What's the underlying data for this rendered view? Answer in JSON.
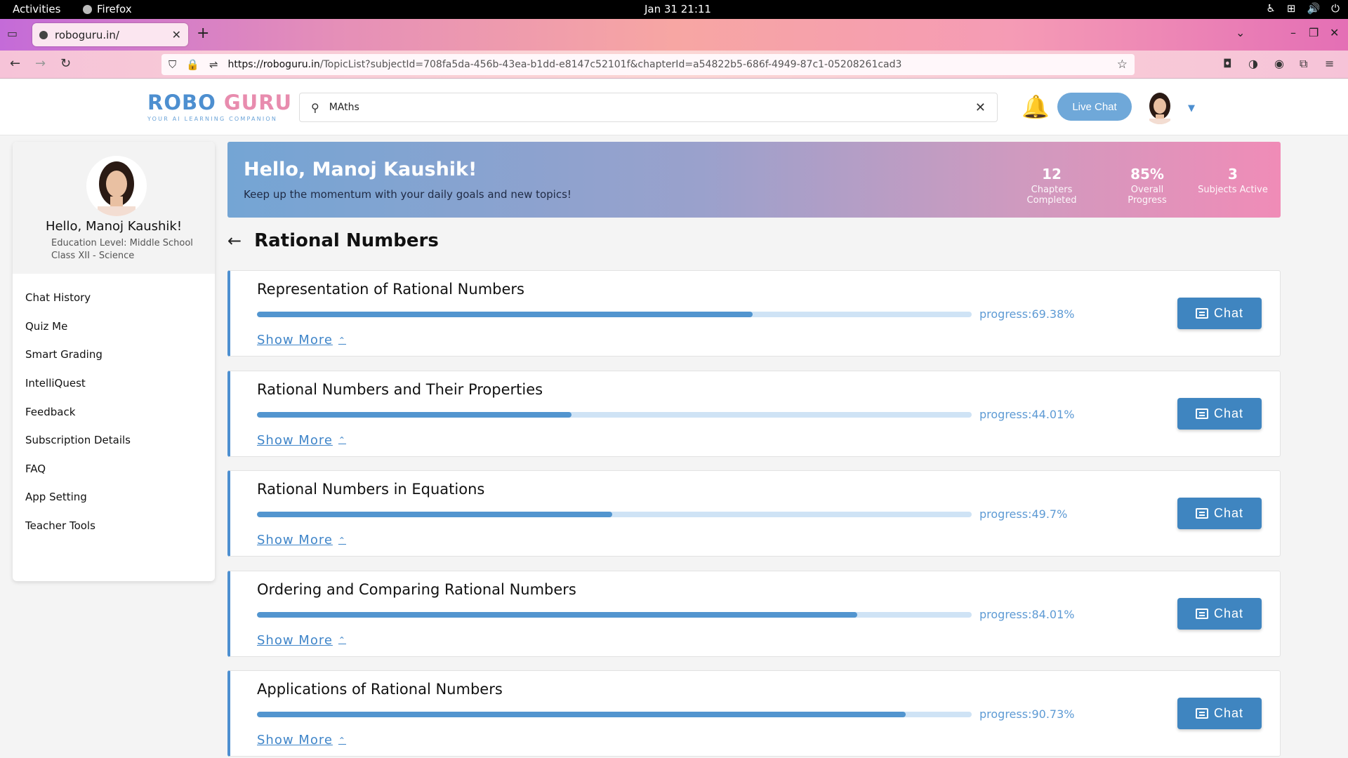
{
  "system_bar": {
    "activities": "Activities",
    "app_name": "Firefox",
    "datetime": "Jan 31  21:11"
  },
  "browser": {
    "tab_title": "roboguru.in/",
    "url_host": "https://roboguru.in",
    "url_path": "/TopicList?subjectId=708fa5da-456b-43ea-b1dd-e8147c52101f&chapterId=a54822b5-686f-4949-87c1-05208261cad3"
  },
  "header": {
    "logo_robo": "ROBO",
    "logo_guru": "GURU",
    "logo_tagline": "YOUR AI LEARNING COMPANION",
    "search_value": "MAths",
    "live_chat_label": "Live Chat"
  },
  "sidebar": {
    "profile_name": "Hello, Manoj Kaushik!",
    "education_level": "Education Level: Middle School",
    "class_info": "Class XII - Science",
    "items": [
      {
        "label": "Chat History"
      },
      {
        "label": "Quiz Me"
      },
      {
        "label": "Smart Grading"
      },
      {
        "label": "IntelliQuest"
      },
      {
        "label": "Feedback"
      },
      {
        "label": "Subscription Details"
      },
      {
        "label": "FAQ"
      },
      {
        "label": "App Setting"
      },
      {
        "label": "Teacher Tools"
      }
    ]
  },
  "banner": {
    "greeting": "Hello, Manoj Kaushik!",
    "tagline": "Keep up the momentum with your daily goals and new topics!",
    "stats": [
      {
        "value": "12",
        "label": "Chapters Completed"
      },
      {
        "value": "85%",
        "label": "Overall Progress"
      },
      {
        "value": "3",
        "label": "Subjects Active"
      }
    ]
  },
  "page": {
    "title": "Rational Numbers"
  },
  "topics": [
    {
      "title": "Representation of Rational Numbers",
      "progress": 69.38,
      "progress_label": "progress:69.38%",
      "show_more": "Show More",
      "chat_label": "Chat"
    },
    {
      "title": "Rational Numbers and Their Properties",
      "progress": 44.01,
      "progress_label": "progress:44.01%",
      "show_more": "Show More",
      "chat_label": "Chat"
    },
    {
      "title": "Rational Numbers in Equations",
      "progress": 49.7,
      "progress_label": "progress:49.7%",
      "show_more": "Show More",
      "chat_label": "Chat"
    },
    {
      "title": "Ordering and Comparing Rational Numbers",
      "progress": 84.01,
      "progress_label": "progress:84.01%",
      "show_more": "Show More",
      "chat_label": "Chat"
    },
    {
      "title": "Applications of Rational Numbers",
      "progress": 90.73,
      "progress_label": "progress:90.73%",
      "show_more": "Show More",
      "chat_label": "Chat"
    }
  ],
  "colors": {
    "accent": "#4d8fd0",
    "chat_button": "#3f85c0",
    "progress_fill": "#5295cf",
    "progress_track": "#cfe3f5",
    "bell": "#f3b60f"
  }
}
